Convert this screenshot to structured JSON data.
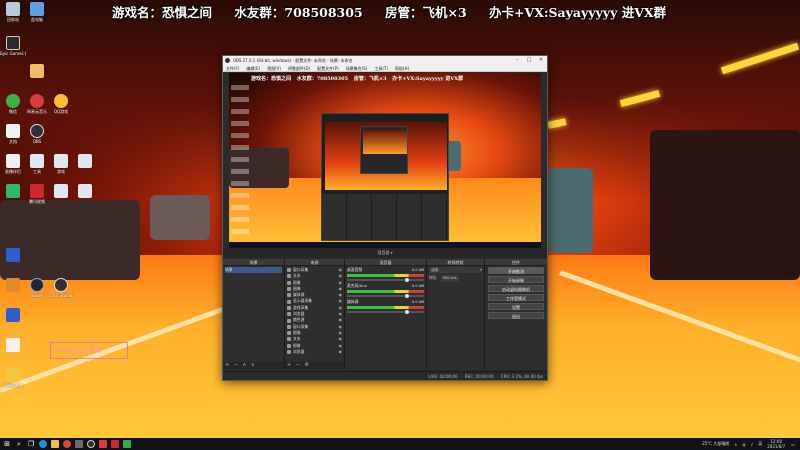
{
  "banner": {
    "game": "游戏名：恐惧之间",
    "qq_group": "水友群：708508305",
    "room_admin": "房管：飞机×3",
    "vx": "办卡+VX:Sayayyyyy 进VX群"
  },
  "desktop_icons": [
    {
      "label": "回收站",
      "icon": "recycle-bin-icon"
    },
    {
      "label": "此电脑",
      "icon": "computer-icon"
    },
    {
      "label": "Epic Games Launcher",
      "icon": "epic-games-icon"
    },
    {
      "label": "微信",
      "icon": "wechat-icon"
    },
    {
      "label": "网易云音乐",
      "icon": "netease-music-icon"
    },
    {
      "label": "QQ游戏",
      "icon": "qq-game-icon"
    },
    {
      "label": "文档",
      "icon": "document-icon"
    },
    {
      "label": "OBS",
      "icon": "obs-icon"
    },
    {
      "label": "直播伴侣",
      "icon": "stream-companion-icon"
    },
    {
      "label": "工具",
      "icon": "tool-icon"
    },
    {
      "label": "游戏",
      "icon": "game-icon"
    },
    {
      "label": "腾讯视频",
      "icon": "video-icon"
    },
    {
      "label": "Steam",
      "icon": "steam-icon"
    },
    {
      "label": "OBS Studio",
      "icon": "obs-studio-icon"
    },
    {
      "label": "WeGame",
      "icon": "wegame-icon"
    }
  ],
  "side_tag": "Sayayyyyy 直播",
  "obs": {
    "title": "OBS 27.0.1 (64-bit, windows) - 配置文件: 未命名 - 场景: 未命名",
    "menu": [
      "文件(F)",
      "编辑(E)",
      "视图(V)",
      "停靠部件(D)",
      "配置文件(P)",
      "场景集合(S)",
      "工具(T)",
      "帮助(H)"
    ],
    "mixer_label": "混音器 ▾",
    "docks": {
      "scenes": {
        "title": "场景",
        "items": [
          "场景"
        ]
      },
      "sources": {
        "title": "来源",
        "items": [
          "窗口采集",
          "文本",
          "图像",
          "图像",
          "媒体源",
          "显示器采集",
          "游戏采集",
          "浏览器",
          "颜色源",
          "窗口采集",
          "图像",
          "文本",
          "图像",
          "浏览器"
        ]
      },
      "mixer": {
        "title": "混音器",
        "channels": [
          {
            "name": "桌面音频",
            "db": "0.0 dB"
          },
          {
            "name": "麦克风/Aux",
            "db": "0.0 dB"
          },
          {
            "name": "媒体源",
            "db": "0.0 dB"
          }
        ]
      },
      "transitions": {
        "title": "转场特效",
        "type": "淡出",
        "duration_label": "时长",
        "duration": "300 ms"
      },
      "controls": {
        "title": "控件",
        "buttons": [
          "开始推流",
          "开始录制",
          "启动虚拟摄像机",
          "工作室模式",
          "设置",
          "退出"
        ]
      }
    },
    "status": [
      "LIVE: 00:00:00",
      "REC: 00:00:00",
      "CPU: 3.2%, 60.00 fps"
    ]
  },
  "taskbar": {
    "weather": "25°C 大部晴朗",
    "clock_time": "12:00",
    "clock_date": "2021/8/7",
    "lang": "英"
  }
}
